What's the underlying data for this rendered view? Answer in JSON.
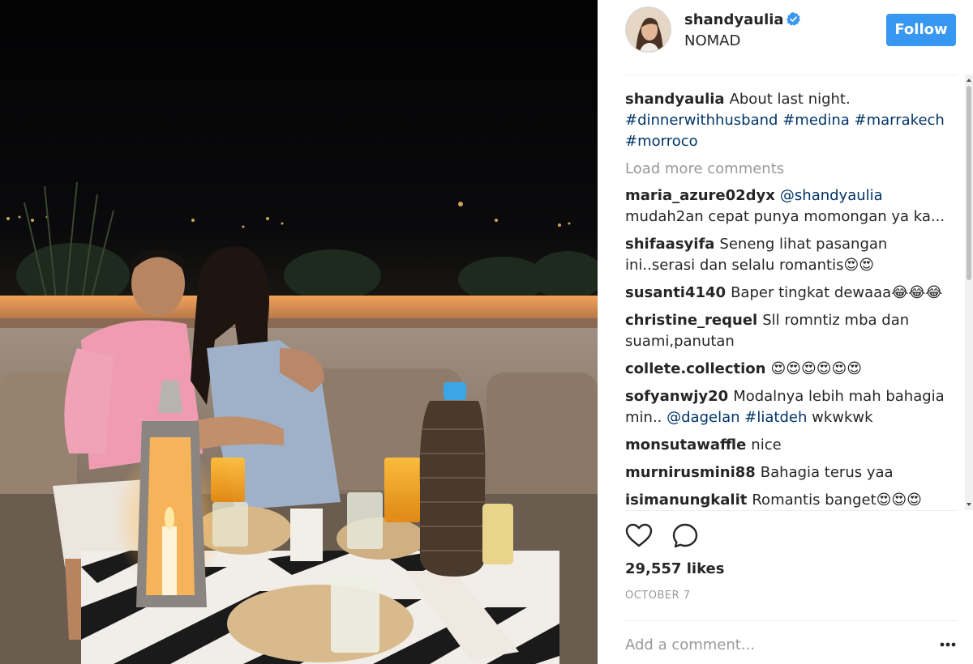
{
  "post": {
    "image_description_icon": "photo",
    "author": {
      "username": "shandyaulia",
      "verified_icon": "verified-badge-icon",
      "location": "NOMAD",
      "follow_label": "Follow"
    },
    "caption": {
      "username": "shandyaulia",
      "text": "About last night.",
      "hashtags": [
        "#dinnerwithhusband",
        "#medina",
        "#marrakech",
        "#morroco"
      ]
    },
    "load_more_label": "Load more comments",
    "comments": [
      {
        "user": "maria_azure02dyx",
        "mention": "@shandyaulia",
        "text": "mudah2an cepat punya momongan ya ka..."
      },
      {
        "user": "shifaasyifa",
        "text": "Seneng lihat pasangan ini..serasi dan selalu romantis😍😍"
      },
      {
        "user": "susanti4140",
        "text": "Baper tingkat dewaaa😂😂😂"
      },
      {
        "user": "christine_requel",
        "text": "Sll romntiz mba dan suami,panutan"
      },
      {
        "user": "collete.collection",
        "text": "😍😍😍😍😍😍"
      },
      {
        "user": "sofyanwjy20",
        "text_before": "Modalnya lebih mah bahagia min..",
        "mention": "@dagelan",
        "hashtag": "#liatdeh",
        "text_after": "wkwkwk"
      },
      {
        "user": "monsutawaffle",
        "text": "nice"
      },
      {
        "user": "murnirusmini88",
        "text": "Bahagia terus yaa"
      },
      {
        "user": "isimanungkalit",
        "text": "Romantis banget😍😍😍"
      }
    ],
    "likes_label": "29,557 likes",
    "date_label": "OCTOBER 7",
    "add_comment_placeholder": "Add a comment...",
    "colors": {
      "follow_button": "#3897f0",
      "hashtag": "#003569",
      "muted": "#999999",
      "text": "#262626"
    }
  }
}
